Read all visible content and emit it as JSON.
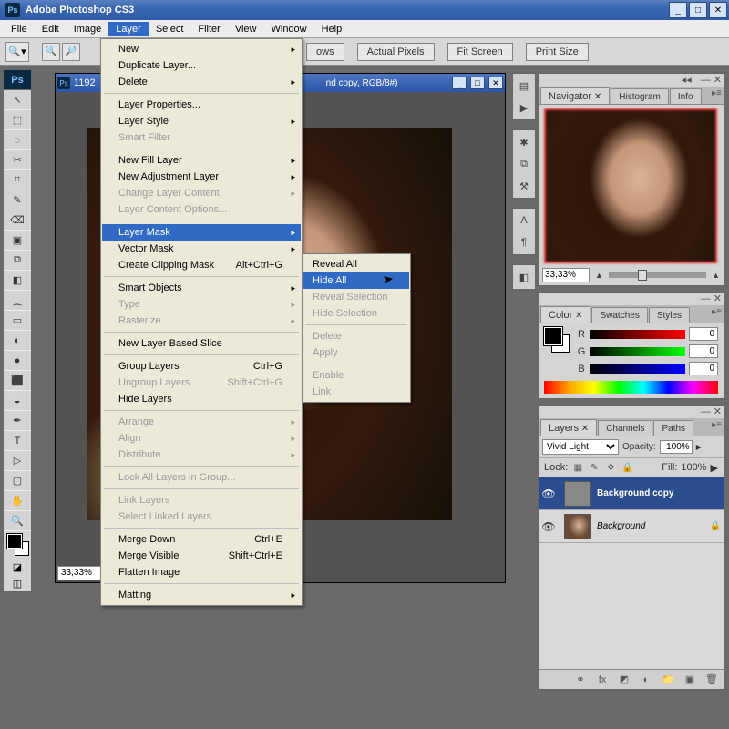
{
  "app": {
    "title": "Adobe Photoshop CS3",
    "badge": "Ps"
  },
  "menu": {
    "items": [
      "File",
      "Edit",
      "Image",
      "Layer",
      "Select",
      "Filter",
      "View",
      "Window",
      "Help"
    ],
    "open_index": 3
  },
  "options_bar": {
    "buttons": [
      "Actual Pixels",
      "Fit Screen",
      "Print Size"
    ],
    "obscured_btn": "ows"
  },
  "document": {
    "title_prefix": "1192",
    "title_suffix": "nd copy, RGB/8#)",
    "zoom": "33,33%"
  },
  "layer_menu": {
    "groups": [
      [
        {
          "label": "New",
          "sub": true
        },
        {
          "label": "Duplicate Layer..."
        },
        {
          "label": "Delete",
          "sub": true
        }
      ],
      [
        {
          "label": "Layer Properties..."
        },
        {
          "label": "Layer Style",
          "sub": true
        },
        {
          "label": "Smart Filter",
          "disabled": true
        }
      ],
      [
        {
          "label": "New Fill Layer",
          "sub": true
        },
        {
          "label": "New Adjustment Layer",
          "sub": true
        },
        {
          "label": "Change Layer Content",
          "disabled": true,
          "sub": true
        },
        {
          "label": "Layer Content Options...",
          "disabled": true
        }
      ],
      [
        {
          "label": "Layer Mask",
          "sub": true,
          "highlight": true
        },
        {
          "label": "Vector Mask",
          "sub": true
        },
        {
          "label": "Create Clipping Mask",
          "shortcut": "Alt+Ctrl+G"
        }
      ],
      [
        {
          "label": "Smart Objects",
          "sub": true
        },
        {
          "label": "Type",
          "disabled": true,
          "sub": true
        },
        {
          "label": "Rasterize",
          "disabled": true,
          "sub": true
        }
      ],
      [
        {
          "label": "New Layer Based Slice"
        }
      ],
      [
        {
          "label": "Group Layers",
          "shortcut": "Ctrl+G"
        },
        {
          "label": "Ungroup Layers",
          "shortcut": "Shift+Ctrl+G",
          "disabled": true
        },
        {
          "label": "Hide Layers"
        }
      ],
      [
        {
          "label": "Arrange",
          "disabled": true,
          "sub": true
        },
        {
          "label": "Align",
          "disabled": true,
          "sub": true
        },
        {
          "label": "Distribute",
          "disabled": true,
          "sub": true
        }
      ],
      [
        {
          "label": "Lock All Layers in Group...",
          "disabled": true
        }
      ],
      [
        {
          "label": "Link Layers",
          "disabled": true
        },
        {
          "label": "Select Linked Layers",
          "disabled": true
        }
      ],
      [
        {
          "label": "Merge Down",
          "shortcut": "Ctrl+E"
        },
        {
          "label": "Merge Visible",
          "shortcut": "Shift+Ctrl+E"
        },
        {
          "label": "Flatten Image"
        }
      ],
      [
        {
          "label": "Matting",
          "sub": true
        }
      ]
    ]
  },
  "layer_mask_submenu": [
    {
      "label": "Reveal All"
    },
    {
      "label": "Hide All",
      "highlight": true
    },
    {
      "label": "Reveal Selection",
      "disabled": true
    },
    {
      "label": "Hide Selection",
      "disabled": true
    },
    "-",
    {
      "label": "Delete",
      "disabled": true
    },
    {
      "label": "Apply",
      "disabled": true
    },
    "-",
    {
      "label": "Enable",
      "disabled": true
    },
    {
      "label": "Link",
      "disabled": true
    }
  ],
  "navigator": {
    "tabs": [
      "Navigator",
      "Histogram",
      "Info"
    ],
    "zoom": "33,33%"
  },
  "color": {
    "tabs": [
      "Color",
      "Swatches",
      "Styles"
    ],
    "channels": [
      {
        "label": "R",
        "value": "0"
      },
      {
        "label": "G",
        "value": "0"
      },
      {
        "label": "B",
        "value": "0"
      }
    ]
  },
  "layers_panel": {
    "tabs": [
      "Layers",
      "Channels",
      "Paths"
    ],
    "blend_mode": "Vivid Light",
    "opacity_label": "Opacity:",
    "opacity": "100%",
    "lock_label": "Lock:",
    "fill_label": "Fill:",
    "fill": "100%",
    "layers": [
      {
        "name": "Background copy",
        "selected": true,
        "bold": true
      },
      {
        "name": "Background",
        "locked": true,
        "italic": true
      }
    ]
  },
  "tools": [
    "↖",
    "⬚",
    "◌",
    "✂",
    "⌗",
    "✎",
    "⌫",
    "▣",
    "⧉",
    "◧",
    "⁔",
    "▭",
    "◐",
    "●",
    "⬛",
    "◒",
    "✒",
    "T",
    "▷",
    "▢",
    "✋",
    "🔍"
  ]
}
